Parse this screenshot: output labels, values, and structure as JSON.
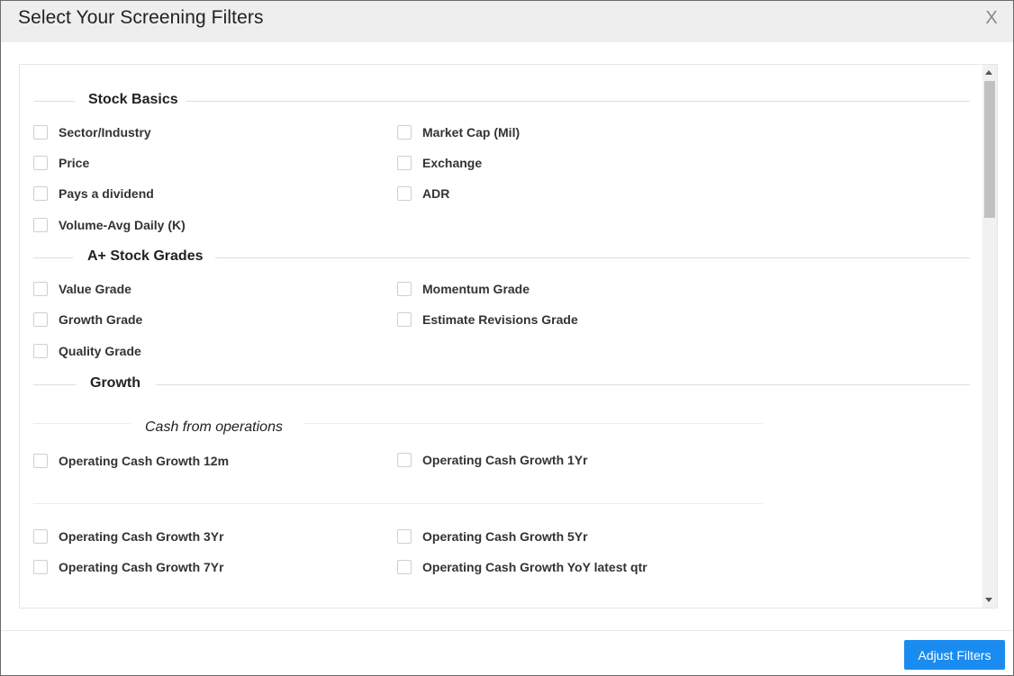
{
  "modal": {
    "title": "Select Your Screening Filters",
    "close_glyph": "X",
    "adjust_label": "Adjust Filters"
  },
  "sections": {
    "stock_basics": {
      "title": "Stock Basics",
      "items": [
        "Sector/Industry",
        "Market Cap (Mil)",
        "Price",
        "Exchange",
        "Pays a dividend",
        "ADR",
        "Volume-Avg Daily (K)"
      ]
    },
    "grades": {
      "title": "A+ Stock Grades",
      "items": [
        "Value Grade",
        "Momentum Grade",
        "Growth Grade",
        "Estimate Revisions Grade",
        "Quality Grade"
      ]
    },
    "growth": {
      "title": "Growth",
      "subsection": "Cash from operations",
      "items": [
        "Operating Cash Growth 12m",
        "Operating Cash Growth 1Yr",
        "Operating Cash Growth 3Yr",
        "Operating Cash Growth 5Yr",
        "Operating Cash Growth 7Yr",
        "Operating Cash Growth YoY latest qtr"
      ]
    }
  },
  "colors": {
    "header_bg": "#eeeeee",
    "button": "#1a8cf0",
    "border": "#6b6b6b"
  },
  "icons": {
    "close": "close-icon",
    "scroll_up": "scroll-up-icon",
    "scroll_down": "scroll-down-icon"
  }
}
